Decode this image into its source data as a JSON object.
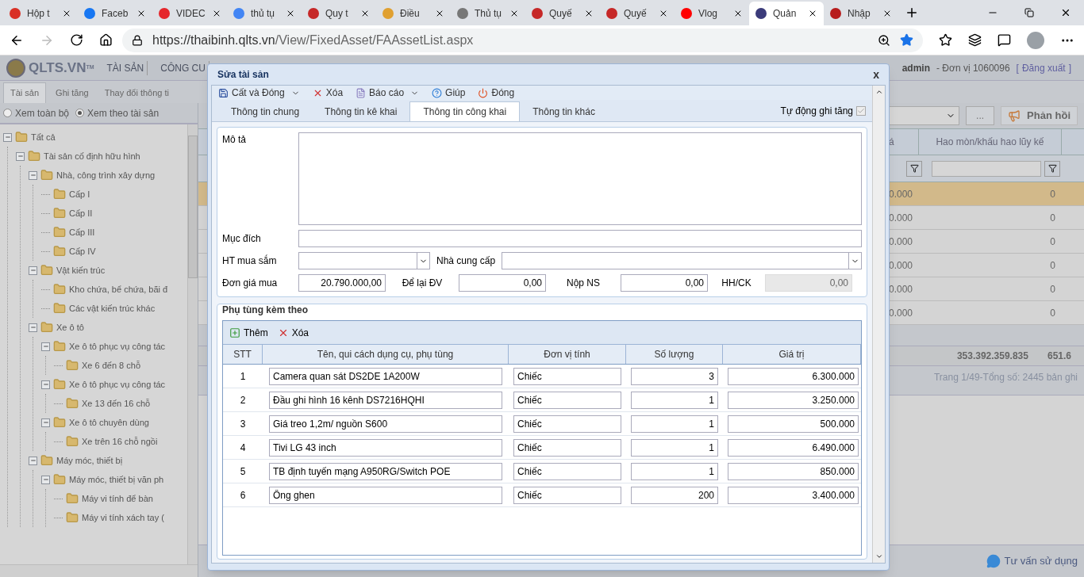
{
  "browser": {
    "tabs": [
      {
        "title": "Hộp t",
        "color": "#d93025",
        "selected": false
      },
      {
        "title": "Faceb",
        "color": "#1877f2",
        "selected": false
      },
      {
        "title": "VIDEC",
        "color": "#e5262b",
        "selected": false
      },
      {
        "title": "thủ tụ",
        "color": "#4285f4",
        "selected": false
      },
      {
        "title": "Quy t",
        "color": "#c62828",
        "selected": false
      },
      {
        "title": "Điều",
        "color": "#e0a030",
        "selected": false
      },
      {
        "title": "Thủ tụ",
        "color": "#777777",
        "selected": false
      },
      {
        "title": "Quyế",
        "color": "#c62828",
        "selected": false
      },
      {
        "title": "Quyế",
        "color": "#c62828",
        "selected": false
      },
      {
        "title": "Vlog",
        "color": "#ff0000",
        "selected": false
      },
      {
        "title": "Quản",
        "color": "#3b3b7a",
        "selected": true
      },
      {
        "title": "Nhập",
        "color": "#b71c1c",
        "selected": false
      }
    ],
    "url_host": "https://thaibinh.qlts.vn",
    "url_path": "/View/FixedAsset/FAAssetList.aspx"
  },
  "app": {
    "logo": "QLTS.VN",
    "logo_tm": "TM",
    "menu": [
      "TÀI SẢN",
      "CÔNG CU"
    ],
    "user": "admin",
    "unit": "- Đơn vị 1060096",
    "logout_open": "[",
    "logout": "Đăng xuất",
    "logout_close": "]",
    "tabs": [
      {
        "label": "Tài sản",
        "selected": true
      },
      {
        "label": "Ghi tăng",
        "selected": false
      },
      {
        "label": "Thay đổi thông ti",
        "selected": false
      }
    ],
    "view_options": [
      {
        "label": "Xem toàn bộ",
        "selected": false
      },
      {
        "label": "Xem theo tài sản",
        "selected": true
      }
    ],
    "tree": [
      {
        "label": "Tất cả",
        "expanded": true,
        "children": [
          {
            "label": "Tài sản cố định hữu hình",
            "expanded": true,
            "children": [
              {
                "label": "Nhà, công trình xây dựng",
                "expanded": true,
                "children": [
                  {
                    "label": "Cấp I"
                  },
                  {
                    "label": "Cấp II"
                  },
                  {
                    "label": "Cấp III"
                  },
                  {
                    "label": "Cấp IV"
                  }
                ]
              },
              {
                "label": "Vật kiến trúc",
                "expanded": true,
                "children": [
                  {
                    "label": "Kho chứa, bể chứa, bãi đ"
                  },
                  {
                    "label": "Các vật kiến trúc khác"
                  }
                ]
              },
              {
                "label": "Xe ô tô",
                "expanded": true,
                "children": [
                  {
                    "label": "Xe ô tô phục vụ công tác",
                    "expanded": true,
                    "children": [
                      {
                        "label": "Xe 6 đến 8 chỗ"
                      }
                    ]
                  },
                  {
                    "label": "Xe ô tô phục vụ công tác",
                    "expanded": true,
                    "children": [
                      {
                        "label": "Xe 13 đến 16 chỗ"
                      }
                    ]
                  },
                  {
                    "label": "Xe ô tô chuyên dùng",
                    "expanded": true,
                    "children": [
                      {
                        "label": "Xe trên 16 chỗ ngồi"
                      }
                    ]
                  }
                ]
              },
              {
                "label": "Máy móc, thiết bị",
                "expanded": true,
                "children": [
                  {
                    "label": "Máy móc, thiết bị văn ph",
                    "expanded": true,
                    "children": [
                      {
                        "label": "Máy vi tính để bàn"
                      },
                      {
                        "label": "Máy vi tính xách tay ("
                      }
                    ]
                  }
                ]
              }
            ]
          }
        ]
      }
    ],
    "more_button": "...",
    "feedback_button": "Phản hồi",
    "grid": {
      "columns": [
        "á",
        "Hao mòn/khấu hao lũy kế"
      ],
      "rows": [
        {
          "column_1": "0.000",
          "depreciation": "0",
          "selected": true
        },
        {
          "column_1": "0.000",
          "depreciation": "0",
          "selected": false
        },
        {
          "column_1": "0.000",
          "depreciation": "0",
          "selected": false
        },
        {
          "column_1": "0.000",
          "depreciation": "0",
          "selected": false
        },
        {
          "column_1": "0.000",
          "depreciation": "0",
          "selected": false
        },
        {
          "column_1": "0.000",
          "depreciation": "0",
          "selected": false
        }
      ],
      "totals": [
        "353.392.359.835",
        "651.6"
      ],
      "paging": "Trang 1/49-Tổng số: 2445 bản ghi"
    },
    "support": "Tư vấn sử dụng"
  },
  "dialog": {
    "title": "Sửa tài sản",
    "close": "x",
    "toolbar": [
      {
        "label": "Cất và Đóng",
        "kind": "save",
        "menu": true
      },
      {
        "label": "Xóa",
        "kind": "delete",
        "menu": false
      },
      {
        "label": "Báo cáo",
        "kind": "report",
        "menu": true
      },
      {
        "label": "Giúp",
        "kind": "help",
        "menu": false
      },
      {
        "label": "Đóng",
        "kind": "close",
        "menu": false
      }
    ],
    "tabs": [
      {
        "label": "Thông tin chung",
        "selected": false
      },
      {
        "label": "Thông tin kê khai",
        "selected": false
      },
      {
        "label": "Thông tin công khai",
        "selected": true
      },
      {
        "label": "Thông tin khác",
        "selected": false
      }
    ],
    "auto_increase": {
      "label": "Tự động ghi tăng",
      "checked": true
    },
    "form": {
      "description_label": "Mô tả",
      "purpose_label": "Mục đích",
      "purchase_method_label": "HT mua sắm",
      "supplier_label": "Nhà cung cấp",
      "unit_price": {
        "label": "Đơn giá mua",
        "value": "20.790.000,00"
      },
      "retained": {
        "label": "Để lại ĐV",
        "value": "0,00"
      },
      "paid_state": {
        "label": "Nộp NS",
        "value": "0,00"
      },
      "discount": {
        "label": "HH/CK",
        "value": "0,00",
        "disabled": true
      }
    },
    "accessories": {
      "title": "Phụ tùng kèm theo",
      "add": "Thêm",
      "delete": "Xóa",
      "columns": [
        "STT",
        "Tên, qui cách dụng cụ, phụ tùng",
        "Đơn vị tính",
        "Số lượng",
        "Giá trị"
      ],
      "rows": [
        {
          "no": "1",
          "name": "Camera quan sát DS2DE 1A200W",
          "unit": "Chiếc",
          "qty": "3",
          "value": "6.300.000"
        },
        {
          "no": "2",
          "name": "Đầu ghi hình 16 kênh DS7216HQHI",
          "unit": "Chiếc",
          "qty": "1",
          "value": "3.250.000"
        },
        {
          "no": "3",
          "name": "Giá treo 1,2m/ nguồn S600",
          "unit": "Chiếc",
          "qty": "1",
          "value": "500.000"
        },
        {
          "no": "4",
          "name": "Tivi LG 43 inch",
          "unit": "Chiếc",
          "qty": "1",
          "value": "6.490.000"
        },
        {
          "no": "5",
          "name": "TB định tuyến mạng A950RG/Switch POE",
          "unit": "Chiếc",
          "qty": "1",
          "value": "850.000"
        },
        {
          "no": "6",
          "name": "Ống ghen",
          "unit": "Chiếc",
          "qty": "200",
          "value": "3.400.000"
        }
      ]
    }
  }
}
